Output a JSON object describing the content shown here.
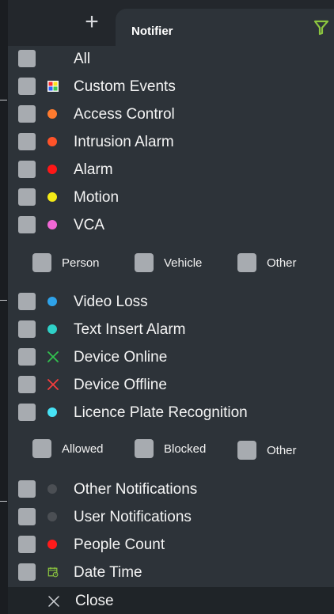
{
  "window": {
    "tab_title": "Notifier",
    "plus_glyph": "+",
    "filter_icon": "filter-icon",
    "accent_color": "#8cc63f"
  },
  "main_items": [
    {
      "label": "All",
      "icon": "none"
    },
    {
      "label": "Custom Events",
      "icon": "custom-events-icon"
    },
    {
      "label": "Access Control",
      "icon": "dot",
      "color": "#ff7b2f"
    },
    {
      "label": "Intrusion Alarm",
      "icon": "dot",
      "color": "#ff5329"
    },
    {
      "label": "Alarm",
      "icon": "dot",
      "color": "#ff1717"
    },
    {
      "label": "Motion",
      "icon": "dot",
      "color": "#f4ea17"
    },
    {
      "label": "VCA",
      "icon": "dot",
      "color": "#f168d6"
    },
    {
      "label": "Video Loss",
      "icon": "dot",
      "color": "#2ea3ea"
    },
    {
      "label": "Text Insert Alarm",
      "icon": "dot",
      "color": "#2fd1c8"
    },
    {
      "label": "Device Online",
      "icon": "x-icon",
      "color": "#31c34f"
    },
    {
      "label": "Device Offline",
      "icon": "x-icon",
      "color": "#f43d3d"
    },
    {
      "label": "Licence Plate Recognition",
      "icon": "dot",
      "color": "#47e3f6"
    },
    {
      "label": "Other Notifications",
      "icon": "dot",
      "color": "#4b4f54"
    },
    {
      "label": "User Notifications",
      "icon": "dot",
      "color": "#4b4f54"
    },
    {
      "label": "People Count",
      "icon": "dot",
      "color": "#ff1b1b"
    },
    {
      "label": "Date Time",
      "icon": "calendar-icon",
      "color": "#8cc63f"
    }
  ],
  "vca_sub_items": [
    {
      "label": "Person"
    },
    {
      "label": "Vehicle"
    },
    {
      "label": "Other"
    }
  ],
  "lpr_sub_items": [
    {
      "label": "Allowed"
    },
    {
      "label": "Blocked"
    },
    {
      "label": "Other"
    }
  ],
  "footer": {
    "close_label": "Close"
  }
}
